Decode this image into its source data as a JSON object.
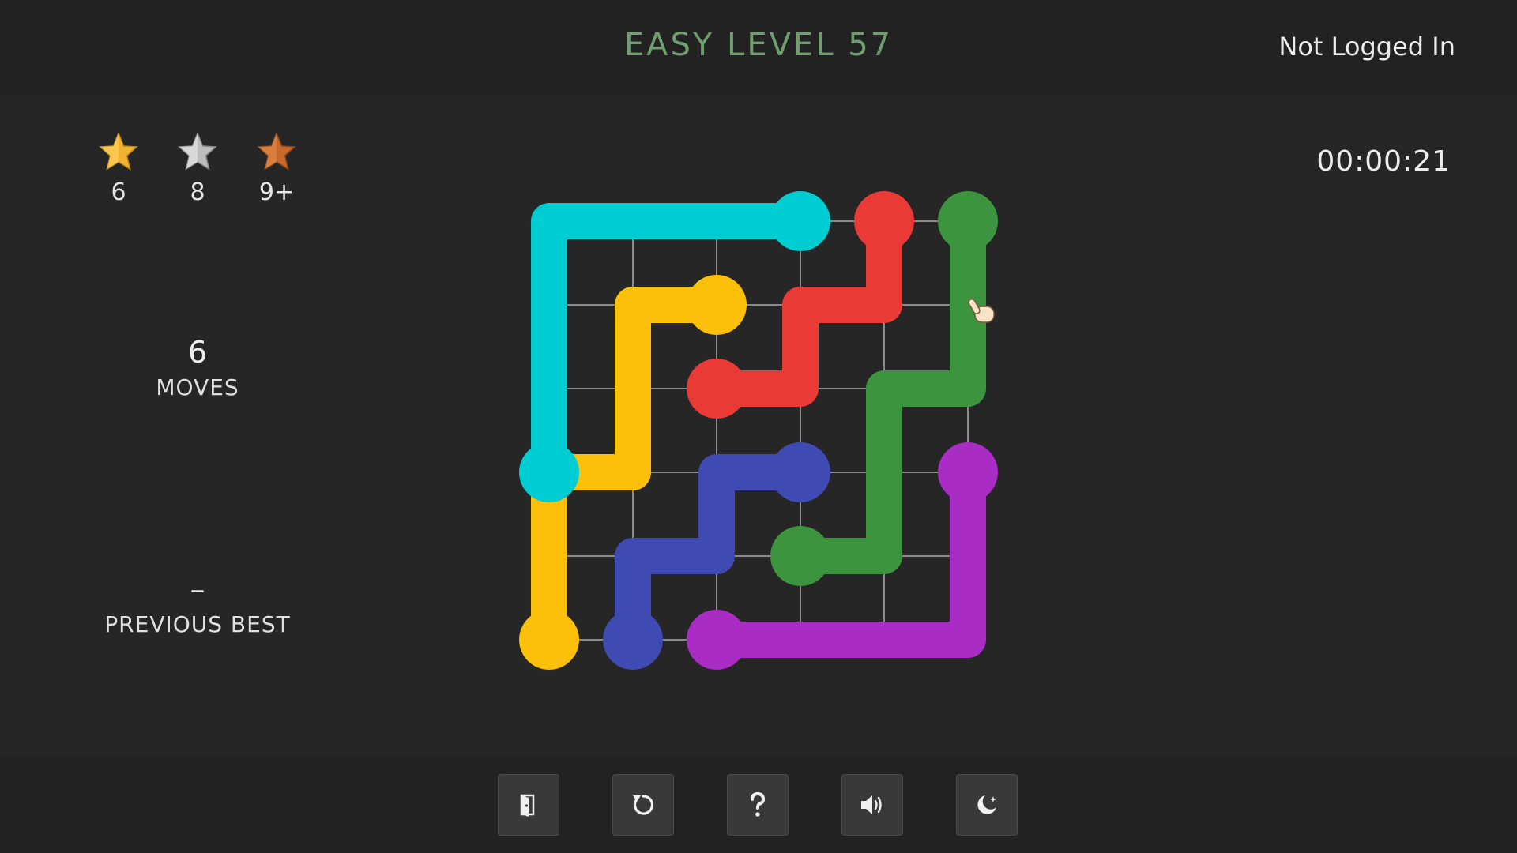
{
  "header": {
    "title": "EASY LEVEL 57",
    "login_status": "Not Logged In"
  },
  "stars": [
    {
      "icon": "gold-star-icon",
      "threshold": "6",
      "color": "#f2b233"
    },
    {
      "icon": "silver-star-icon",
      "threshold": "8",
      "color": "#c8c8c8"
    },
    {
      "icon": "bronze-star-icon",
      "threshold": "9+",
      "color": "#c8692c"
    }
  ],
  "timer": "00:00:21",
  "stats": {
    "moves_value": "6",
    "moves_label": "MOVES",
    "best_value": "–",
    "best_label": "PREVIOUS BEST"
  },
  "board": {
    "grid_size": 6,
    "grid_color": "#8a8a8a",
    "flows": [
      {
        "color": "cyan",
        "hex": "#00cdd1",
        "path": [
          [
            0,
            3
          ],
          [
            0,
            2
          ],
          [
            0,
            1
          ],
          [
            0,
            0
          ],
          [
            1,
            0
          ],
          [
            2,
            0
          ],
          [
            3,
            0
          ]
        ]
      },
      {
        "color": "red",
        "hex": "#ea3a35",
        "path": [
          [
            4,
            0
          ],
          [
            4,
            1
          ],
          [
            3,
            1
          ],
          [
            3,
            2
          ],
          [
            2,
            2
          ]
        ]
      },
      {
        "color": "green",
        "hex": "#3c943f",
        "path": [
          [
            5,
            0
          ],
          [
            5,
            1
          ],
          [
            5,
            2
          ],
          [
            4,
            2
          ],
          [
            4,
            3
          ],
          [
            4,
            4
          ],
          [
            3,
            4
          ]
        ]
      },
      {
        "color": "yellow",
        "hex": "#fcbf0a",
        "path": [
          [
            2,
            1
          ],
          [
            1,
            1
          ],
          [
            1,
            2
          ],
          [
            1,
            3
          ],
          [
            0,
            3
          ],
          [
            0,
            4
          ],
          [
            0,
            5
          ]
        ]
      },
      {
        "color": "blue",
        "hex": "#3f4ab3",
        "path": [
          [
            3,
            3
          ],
          [
            2,
            3
          ],
          [
            2,
            4
          ],
          [
            1,
            4
          ],
          [
            1,
            5
          ]
        ]
      },
      {
        "color": "purple",
        "hex": "#a92cc4",
        "path": [
          [
            5,
            3
          ],
          [
            5,
            4
          ],
          [
            5,
            5
          ],
          [
            4,
            5
          ],
          [
            3,
            5
          ],
          [
            2,
            5
          ]
        ]
      }
    ],
    "endpoints": [
      {
        "color": "#00cdd1",
        "cells": [
          [
            3,
            0
          ],
          [
            0,
            3
          ]
        ]
      },
      {
        "color": "#ea3a35",
        "cells": [
          [
            4,
            0
          ],
          [
            2,
            2
          ]
        ]
      },
      {
        "color": "#3c943f",
        "cells": [
          [
            5,
            0
          ],
          [
            3,
            4
          ]
        ]
      },
      {
        "color": "#fcbf0a",
        "cells": [
          [
            2,
            1
          ],
          [
            0,
            5
          ]
        ]
      },
      {
        "color": "#3f4ab3",
        "cells": [
          [
            3,
            3
          ],
          [
            1,
            5
          ]
        ]
      },
      {
        "color": "#a92cc4",
        "cells": [
          [
            5,
            3
          ],
          [
            2,
            5
          ]
        ]
      }
    ]
  },
  "toolbar": [
    {
      "name": "exit-button",
      "icon": "exit-door-icon"
    },
    {
      "name": "restart-button",
      "icon": "restart-icon"
    },
    {
      "name": "help-button",
      "icon": "question-mark-icon"
    },
    {
      "name": "sound-button",
      "icon": "speaker-icon"
    },
    {
      "name": "night-mode-button",
      "icon": "moon-icon"
    }
  ]
}
